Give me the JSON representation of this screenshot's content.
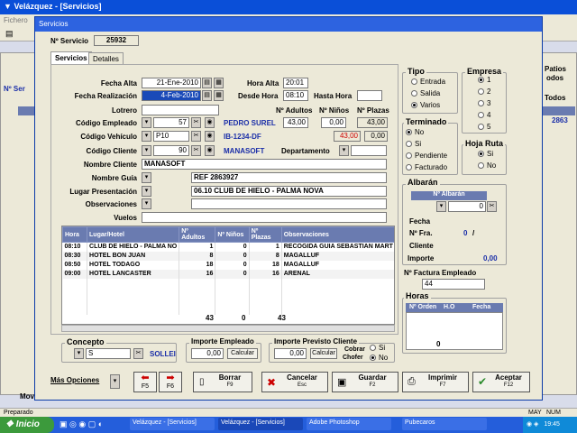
{
  "window": {
    "title": "Velázquez - [Servicios]",
    "dialog_title": "Servicios",
    "status": "Preparado",
    "caps": "MAY",
    "num": "NUM"
  },
  "bg_labels": {
    "menu": "Fichero",
    "pat": "Patios",
    "patb": "odos",
    "ser": "Nº Ser",
    "serv": "Servic",
    "tod": "Todos",
    "num": "2863",
    "mov": "Movi"
  },
  "header": {
    "servicio_label": "Nº Servicio",
    "servicio_value": "25932"
  },
  "tabs": [
    "Servicios",
    "Detalles"
  ],
  "form": {
    "fecha_alta_label": "Fecha Alta",
    "fecha_alta": "21-Ene-2010",
    "hora_alta_label": "Hora Alta",
    "hora_alta": "20:01",
    "fecha_real_label": "Fecha Realización",
    "fecha_real": "4-Feb-2010",
    "desde_hora_label": "Desde Hora",
    "desde_hora": "08:10",
    "hasta_hora_label": "Hasta Hora",
    "hasta_hora": "",
    "lotrero_label": "Lotrero",
    "lotrero": "",
    "adultos_label": "Nº Adultos",
    "ninos_label": "Nº Niños",
    "plazas_label": "Nº Plazas",
    "adultos": "43,00",
    "ninos": "0,00",
    "plazas": "43,00",
    "cod_emp_label": "Código Empleado",
    "cod_emp": "57",
    "emp_name": "PEDRO SUREL",
    "cod_veh_label": "Código Vehículo",
    "cod_veh": "P10",
    "matricula": "IB-1234-DF",
    "red_value": "43,00",
    "zero_value": "0,00",
    "cod_cli_label": "Código Cliente",
    "cod_cli": "90",
    "cli_name": "MANASOFT",
    "depto_label": "Departamento",
    "nombre_cli_label": "Nombre Cliente",
    "nombre_cli": "MANASOFT",
    "nombre_guia_label": "Nombre Guía",
    "nombre_guia": "REF 2863927",
    "lugar_label": "Lugar Presentación",
    "lugar": "06.10 CLUB DE HIELO - PALMA NOVA",
    "obs_label": "Observaciones",
    "obs": "",
    "vuelos_label": "Vuelos",
    "vuelos": ""
  },
  "grid": {
    "columns": [
      "Hora",
      "Lugar/Hotel",
      "Nº Adultos",
      "Nº Niños",
      "Nº Plazas",
      "Observaciones"
    ],
    "rows": [
      [
        "08:10",
        "CLUB DE HIELO - PALMA NO",
        "1",
        "0",
        "1",
        "RECOGIDA GUIA SEBASTIAN MART"
      ],
      [
        "08:30",
        "HOTEL BON JUAN",
        "8",
        "0",
        "8",
        "MAGALLUF"
      ],
      [
        "08:50",
        "HOTEL TODAGO",
        "18",
        "0",
        "18",
        "MAGALLUF"
      ],
      [
        "09:00",
        "HOTEL LANCASTER",
        "16",
        "0",
        "16",
        "ARENAL"
      ]
    ],
    "totals": [
      "43",
      "0",
      "43"
    ]
  },
  "tipo": {
    "title": "Tipo",
    "options": [
      "Entrada",
      "Salida",
      "Varios"
    ],
    "selected": 2
  },
  "empresa": {
    "title": "Empresa",
    "options": [
      "1",
      "2",
      "3",
      "4",
      "5"
    ],
    "selected": 0
  },
  "terminado": {
    "title": "Terminado",
    "options": [
      "No",
      "Si",
      "Pendiente",
      "Facturado"
    ],
    "selected": 0
  },
  "hoja": {
    "title": "Hoja Ruta",
    "options": [
      "Si",
      "No"
    ],
    "selected": 0
  },
  "albaran": {
    "title": "Albarán",
    "col": "Nº Albarán",
    "value": "0",
    "fecha_label": "Fecha",
    "fra_label": "Nº Fra.",
    "fra_value": "0",
    "fra_sep": "/",
    "cliente_label": "Cliente",
    "importe_label": "Importe",
    "importe": "0,00"
  },
  "factura": {
    "label": "Nº Factura Empleado",
    "value": "44"
  },
  "horas": {
    "title": "Horas",
    "columns": [
      "Nº Orden",
      "H.O",
      "Fecha"
    ],
    "value": "0"
  },
  "concepto": {
    "title": "Concepto",
    "value": "S",
    "text": "SOLLEI"
  },
  "importe_emp": {
    "title": "Importe Empleado",
    "value": "0,00",
    "btn": "Calcular"
  },
  "importe_cli": {
    "title": "Importe Previsto Cliente",
    "value": "0,00",
    "btn": "Calcular",
    "cobrar": "Cobrar",
    "chofer": "Chofer",
    "si": "Si",
    "no": "No"
  },
  "buttons": {
    "mas": "Más Opciones",
    "f5": "F5",
    "f6": "F6",
    "borrar": "Borrar",
    "borrar_k": "F9",
    "cancelar": "Cancelar",
    "cancelar_k": "Esc",
    "guardar": "Guardar",
    "guardar_k": "F2",
    "imprimir": "Imprimir",
    "imprimir_k": "F7",
    "aceptar": "Aceptar",
    "aceptar_k": "F12"
  },
  "taskbar": {
    "start": "Inicio",
    "items": [
      "Velázquez - [Servicios]",
      "Velázquez - [Servicios]",
      "Adobe Photoshop",
      "Pubecaros"
    ],
    "clock": "19:45"
  },
  "colors": {
    "accent": "#6a7bb0",
    "title_bar": "#0a4fd8",
    "taskbar": "#245edb",
    "start": "#3c9a3c",
    "red": "#cc0000",
    "blue_text": "#1a2ea8"
  }
}
